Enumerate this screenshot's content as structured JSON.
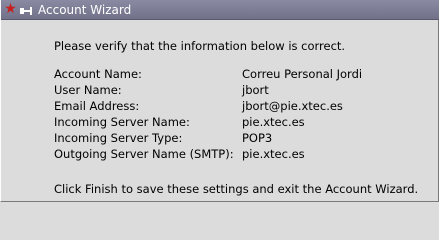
{
  "window": {
    "title": "Account Wizard",
    "app_icon": "star-icon",
    "pin_icon": "pin-icon"
  },
  "page": {
    "intro": "Please verify that the information below is correct.",
    "details": [
      {
        "label": "Account Name:",
        "value": "Correu Personal Jordi"
      },
      {
        "label": "User Name:",
        "value": "jbort"
      },
      {
        "label": "Email Address:",
        "value": "jbort@pie.xtec.es"
      },
      {
        "label": "Incoming Server Name:",
        "value": "pie.xtec.es"
      },
      {
        "label": "Incoming Server Type:",
        "value": "POP3"
      },
      {
        "label": "Outgoing Server Name (SMTP):",
        "value": "pie.xtec.es"
      }
    ],
    "outro": "Click Finish to save these settings and exit the Account Wizard."
  },
  "colors": {
    "titlebar": "#7e7e96",
    "background": "#dcdcdc",
    "star": "#c81e1e"
  }
}
